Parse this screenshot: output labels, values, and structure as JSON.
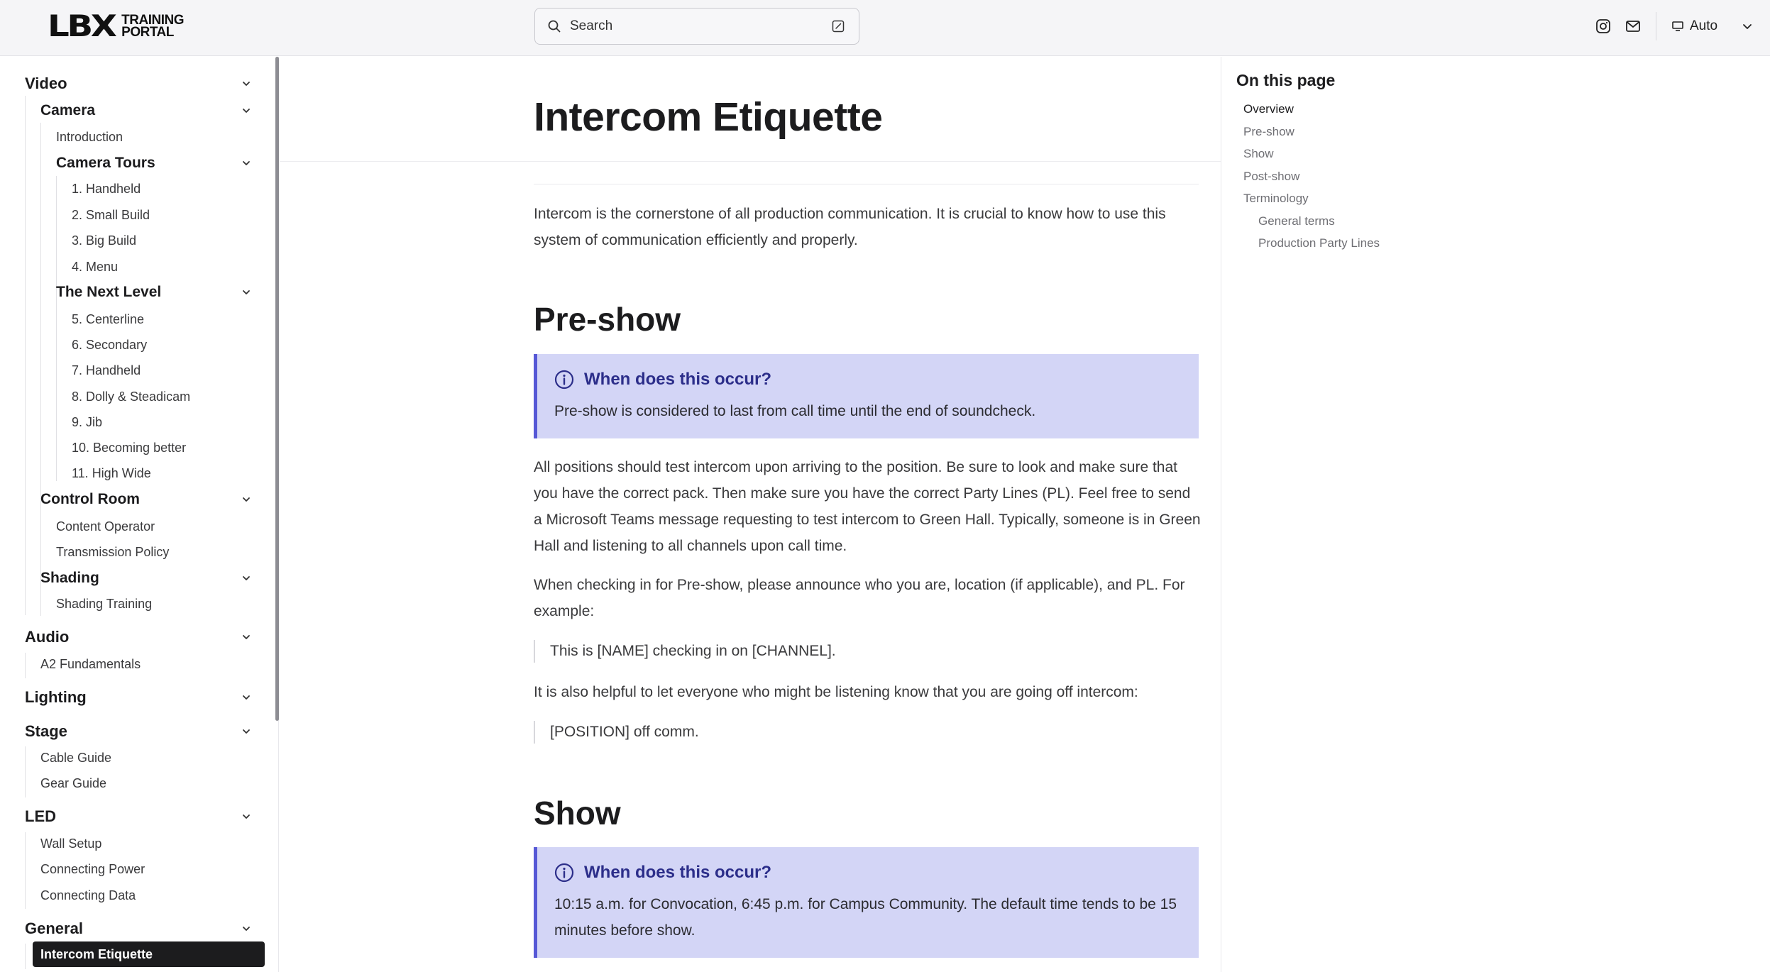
{
  "header": {
    "logo_mark": "LBX",
    "logo_line1": "TRAINING",
    "logo_line2": "PORTAL",
    "search_placeholder": "Search",
    "theme_label": "Auto",
    "icons": [
      "instagram-icon",
      "mail-icon",
      "monitor-icon",
      "chevron-down-icon",
      "search-icon",
      "edit-icon"
    ]
  },
  "sidebar": {
    "video": "Video",
    "camera": "Camera",
    "introduction": "Introduction",
    "camera_tours": "Camera Tours",
    "handheld_1": "1. Handheld",
    "small_build": "2. Small Build",
    "big_build": "3. Big Build",
    "menu": "4. Menu",
    "next_level": "The Next Level",
    "centerline": "5. Centerline",
    "secondary": "6. Secondary",
    "handheld_7": "7. Handheld",
    "dolly": "8. Dolly & Steadicam",
    "jib": "9. Jib",
    "becoming_better": "10. Becoming better",
    "high_wide": "11. High Wide",
    "control_room": "Control Room",
    "content_operator": "Content Operator",
    "transmission_policy": "Transmission Policy",
    "shading": "Shading",
    "shading_training": "Shading Training",
    "audio": "Audio",
    "a2_fundamentals": "A2 Fundamentals",
    "lighting": "Lighting",
    "stage": "Stage",
    "cable_guide": "Cable Guide",
    "gear_guide": "Gear Guide",
    "led": "LED",
    "wall_setup": "Wall Setup",
    "connecting_power": "Connecting Power",
    "connecting_data": "Connecting Data",
    "general": "General",
    "intercom_etiquette": "Intercom Etiquette"
  },
  "main": {
    "title": "Intercom Etiquette",
    "intro": "Intercom is the cornerstone of all production communication. It is crucial to know how to use this system of communication efficiently and properly.",
    "preshow_heading": "Pre-show",
    "preshow_callout_title": "When does this occur?",
    "preshow_callout_body": "Pre-show is considered to last from call time until the end of soundcheck.",
    "preshow_para1": "All positions should test intercom upon arriving to the position. Be sure to look and make sure that you have the correct pack. Then make sure you have the correct Party Lines (PL). Feel free to send a Microsoft Teams message requesting to test intercom to Green Hall. Typically, someone is in Green Hall and listening to all channels upon call time.",
    "preshow_para2": "When checking in for Pre-show, please announce who you are, location (if applicable), and PL. For example:",
    "quote1": "This is [NAME] checking in on [CHANNEL].",
    "preshow_para3": "It is also helpful to let everyone who might be listening know that you are going off intercom:",
    "quote2": "[POSITION] off comm.",
    "show_heading": "Show",
    "show_callout_title": "When does this occur?",
    "show_callout_body": "10:15 a.m. for Convocation, 6:45 p.m. for Campus Community. The default time tends to be 15 minutes before show."
  },
  "toc": {
    "title": "On this page",
    "overview": "Overview",
    "preshow": "Pre-show",
    "show": "Show",
    "postshow": "Post-show",
    "terminology": "Terminology",
    "general_terms": "General terms",
    "party_lines": "Production Party Lines"
  },
  "colors": {
    "callout_bg": "#d3d5f6",
    "callout_border": "#5658d6",
    "callout_title": "#2c2e8a",
    "active_bg": "#1c1c1e"
  }
}
